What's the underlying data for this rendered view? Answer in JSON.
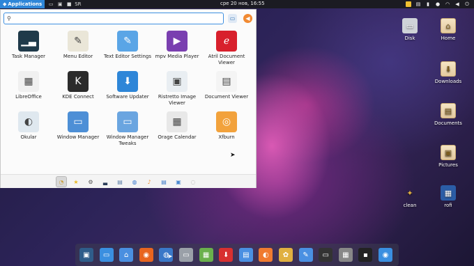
{
  "top_panel": {
    "applications_label": "Applications",
    "keyboard_layout": "SR",
    "clock": "сре 20 нов, 16:55"
  },
  "menu": {
    "search": {
      "value": "",
      "placeholder": ""
    },
    "apps": [
      {
        "label": "Task Manager",
        "icon": "task-manager-icon",
        "color": "#1f3a4a"
      },
      {
        "label": "Menu Editor",
        "icon": "menu-editor-icon",
        "color": "#eae6d8"
      },
      {
        "label": "Text Editor Settings",
        "icon": "text-editor-icon",
        "color": "#5aa5e6"
      },
      {
        "label": "mpv Media Player",
        "icon": "mpv-icon",
        "color": "#7a3fb0"
      },
      {
        "label": "Atril Document Viewer",
        "icon": "atril-icon",
        "color": "#d8202c"
      },
      {
        "label": "LibreOffice",
        "icon": "libreoffice-icon",
        "color": "#f0f0f0"
      },
      {
        "label": "KDE Connect",
        "icon": "kde-connect-icon",
        "color": "#2b2b2b"
      },
      {
        "label": "Software Updater",
        "icon": "software-updater-icon",
        "color": "#2e86d8"
      },
      {
        "label": "Ristretto Image Viewer",
        "icon": "ristretto-icon",
        "color": "#e9eef2"
      },
      {
        "label": "Document Viewer",
        "icon": "document-viewer-icon",
        "color": "#f4f4f4"
      },
      {
        "label": "Okular",
        "icon": "okular-icon",
        "color": "#dfe8ef"
      },
      {
        "label": "Window Manager",
        "icon": "window-manager-icon",
        "color": "#4d8fd6"
      },
      {
        "label": "Window Manager Tweaks",
        "icon": "window-manager-tweaks-icon",
        "color": "#6aa5e0"
      },
      {
        "label": "Orage Calendar",
        "icon": "orage-calendar-icon",
        "color": "#e8e8e8"
      },
      {
        "label": "Xfburn",
        "icon": "xfburn-icon",
        "color": "#f2a23c"
      }
    ],
    "categories": [
      "favorites-icon",
      "star-icon",
      "settings-icon",
      "system-icon",
      "accessories-icon",
      "internet-icon",
      "multimedia-icon",
      "office-icon",
      "graphics-icon",
      "other-icon"
    ]
  },
  "desktop": {
    "icons": [
      {
        "label": "Disk",
        "icon": "disk-icon"
      },
      {
        "label": "Home",
        "icon": "home-folder-icon"
      },
      {
        "label": "Downloads",
        "icon": "downloads-folder-icon"
      },
      {
        "label": "Documents",
        "icon": "documents-folder-icon"
      },
      {
        "label": "Pictures",
        "icon": "pictures-folder-icon"
      },
      {
        "label": "clean",
        "icon": "broom-icon"
      },
      {
        "label": "rofi",
        "icon": "rofi-icon"
      }
    ]
  },
  "dock": {
    "items": [
      "screenshot-icon",
      "desktop-icon",
      "file-manager-icon",
      "firefox-icon",
      "web-browser-icon",
      "drive-icon",
      "spreadsheet-icon",
      "installer-icon",
      "text-document-icon",
      "presentation-icon",
      "photo-editor-icon",
      "text-editor-icon",
      "screen-capture-icon",
      "calculator-icon",
      "terminal-icon",
      "toggle-icon"
    ]
  },
  "colors": {
    "accent": "#2e86d8",
    "logout": "#f18a32"
  }
}
